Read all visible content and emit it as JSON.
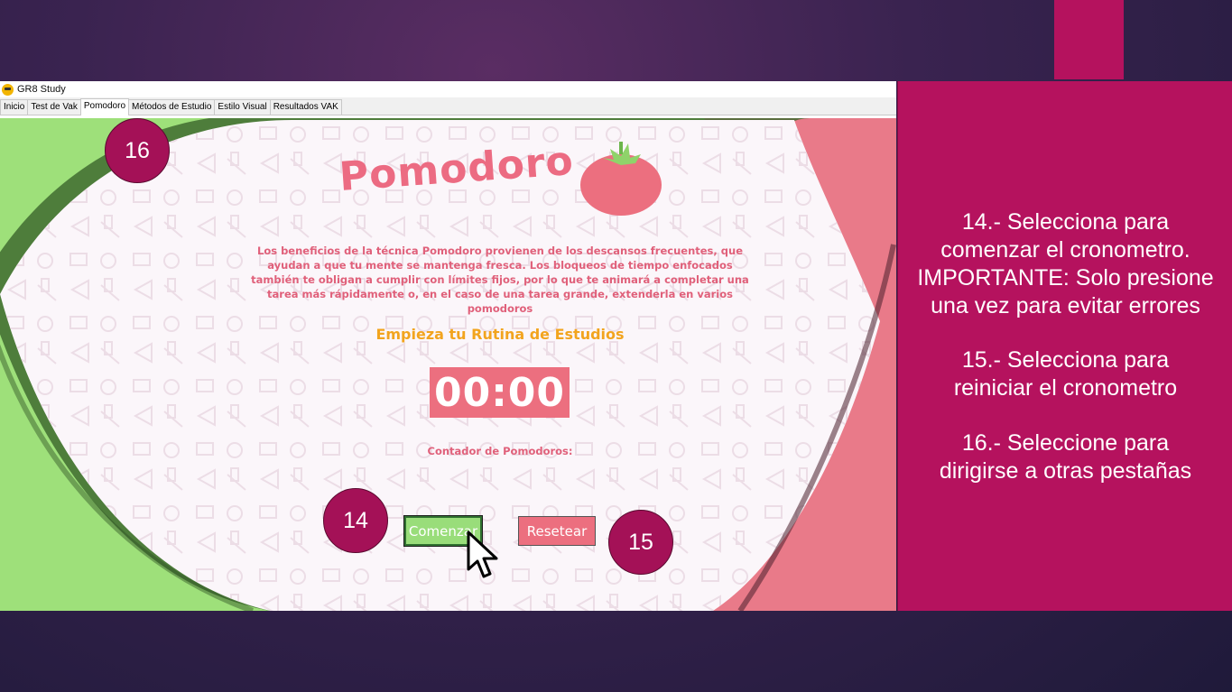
{
  "window": {
    "title": "GR8 Study",
    "tabs": [
      "Inicio",
      "Test de Vak",
      "Pomodoro",
      "Métodos de Estudio",
      "Estilo Visual",
      "Resultados VAK"
    ],
    "active_tab": "Pomodoro"
  },
  "pomodoro": {
    "title": "Pomodoro",
    "description": "Los beneficios de la técnica Pomodoro provienen de los descansos frecuentes, que ayudan a que tu mente se mantenga fresca. Los bloqueos de tiempo enfocados también te obligan a cumplir con límites fijos, por lo que te animará a completar una tarea más rápidamente o, en el caso de una tarea grande, extenderla en varios pomodoros",
    "subtitle": "Empieza tu Rutina de Estudios",
    "timer": "00:00",
    "counter_label": "Contador de Pomodoros:",
    "start_button": "Comenzar",
    "reset_button": "Resetear"
  },
  "badges": {
    "tabs": "16",
    "start": "14",
    "reset": "15"
  },
  "instructions": {
    "step14": [
      "14.- Selecciona para",
      "comenzar el cronometro.",
      "IMPORTANTE: Solo presione",
      "una vez para evitar errores"
    ],
    "step15": [
      "15.- Selecciona para",
      "reiniciar el cronometro"
    ],
    "step16": [
      "16.- Seleccione para",
      "dirigirse a otras pestañas"
    ]
  },
  "colors": {
    "accent_magenta": "#b5125e",
    "badge": "#a41157",
    "pomodoro_pink": "#ec6f7f",
    "subtitle_orange": "#f2a41e",
    "green": "#9ee07a"
  },
  "icons": [
    "app-icon",
    "tomato-icon",
    "mouse-pointer-icon"
  ]
}
